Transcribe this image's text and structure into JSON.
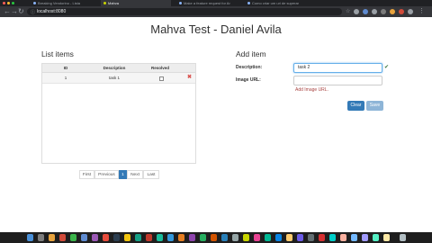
{
  "browser": {
    "tabs": [
      {
        "label": "Breaking Vendorino - Lista",
        "active": false
      },
      {
        "label": "Mahva",
        "active": true
      },
      {
        "label": "Make a feature request for Ar",
        "active": false
      },
      {
        "label": "Como criar um uri de superar",
        "active": false
      }
    ],
    "url": "localhost:8080"
  },
  "page": {
    "title": "Mahva Test - Daniel Avila",
    "list_heading": "List items",
    "add_heading": "Add item"
  },
  "table": {
    "headers": [
      "ID",
      "Description",
      "Resolved"
    ],
    "rows": [
      {
        "id": "1",
        "description": "task 1"
      }
    ]
  },
  "pagination": {
    "first": "First",
    "previous": "Previous",
    "current": "1",
    "next": "Next",
    "last": "Last"
  },
  "form": {
    "description_label": "Description:",
    "description_value": "task 2",
    "image_label": "Image URL:",
    "image_value": "",
    "image_error": "Add Image URL.",
    "clear_label": "Clear",
    "save_label": "Save"
  },
  "colors": {
    "primary": "#337ab7",
    "error": "#a94442",
    "success": "#3c763d"
  }
}
